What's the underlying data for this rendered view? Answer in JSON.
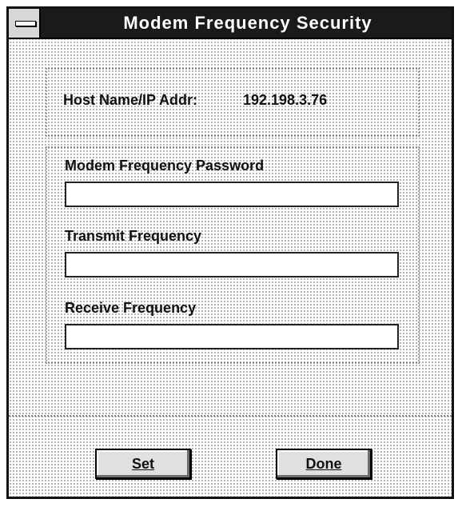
{
  "window": {
    "title": "Modem Frequency Security"
  },
  "host": {
    "label": "Host Name/IP Addr:",
    "value": "192.198.3.76"
  },
  "fields": {
    "password_label": "Modem Frequency Password",
    "password_value": "",
    "transmit_label": "Transmit Frequency",
    "transmit_value": "",
    "receive_label": "Receive Frequency",
    "receive_value": ""
  },
  "buttons": {
    "set_label": "Set",
    "done_label": "Done"
  },
  "icons": {
    "system_menu": "system-menu-icon"
  }
}
